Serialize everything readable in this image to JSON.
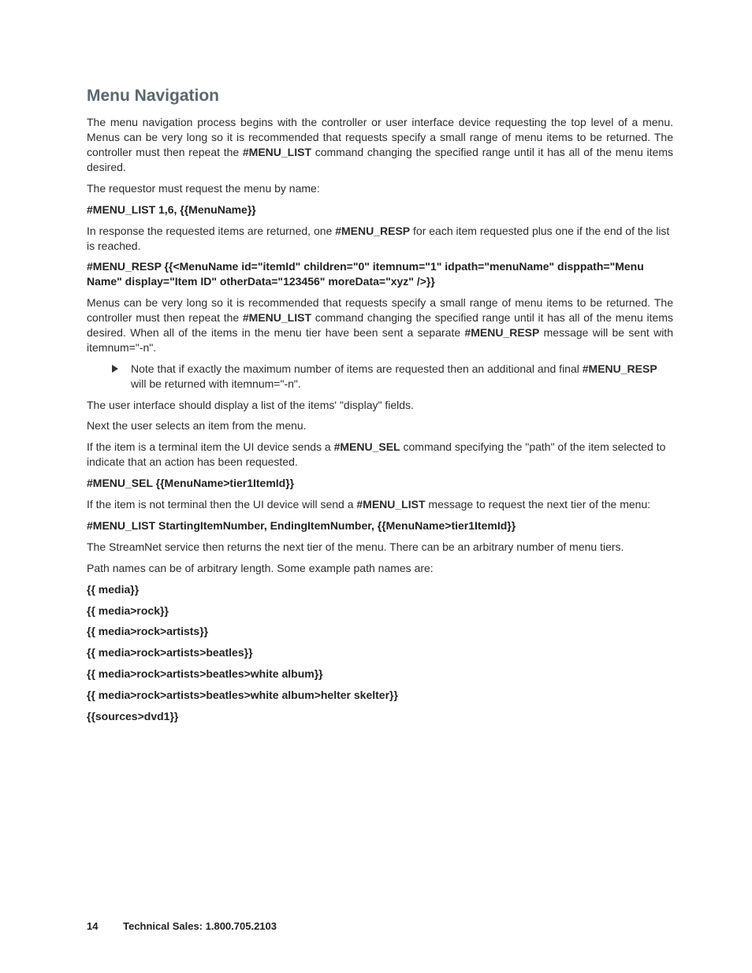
{
  "heading": "Menu Navigation",
  "p1_a": "The menu navigation process begins with the controller or user interface device requesting the top level of a menu. Menus can be very long so it is recommended that requests specify a small range of menu items to be returned. The controller must then repeat the ",
  "p1_cmd": "#MENU_LIST",
  "p1_b": " command changing the specified range until it has all of the menu items desired.",
  "p2": "The requestor must request the menu by name:",
  "cmd1": "#MENU_LIST 1,6, {{MenuName}}",
  "p3_a": "In response the requested items are returned, one ",
  "p3_cmd": "#MENU_RESP",
  "p3_b": " for each item requested plus one if the end of the list is reached.",
  "cmd2": "#MENU_RESP {{<MenuName id=\"itemId\" children=\"0\" itemnum=\"1\" idpath=\"menuName\" disppath=\"Menu Name\" display=\"Item ID\" otherData=\"123456\" moreData=\"xyz\" />}}",
  "p4_a": "Menus can be very long so it is recommended that requests specify a small range of menu items to be returned. The controller must then repeat the ",
  "p4_cmd1": "#MENU_LIST",
  "p4_b": " command changing the specified range until it has all of the menu items desired. When all of the items in the menu tier have been sent a separate ",
  "p4_cmd2": "#MENU_RESP",
  "p4_c": " message will be sent with  itemnum=\"-n\".",
  "note_a": "Note that if exactly the maximum number of items are requested then an additional and final ",
  "note_cmd": "#MENU_RESP",
  "note_b": " will be returned with itemnum=\"-n\".",
  "p5": "The user interface should display a list of the items' \"display\" fields.",
  "p6": "Next the user selects an item from the menu.",
  "p7_a": "If the item is a terminal item the UI device sends a ",
  "p7_cmd": "#MENU_SEL",
  "p7_b": " command specifying the \"path\" of the item selected to indicate that an action has been requested.",
  "cmd3": "#MENU_SEL {{MenuName>tier1ItemId}}",
  "p8_a": "If the item is not terminal then the UI device will send a ",
  "p8_cmd": "#MENU_LIST",
  "p8_b": " message to request the next tier of the menu:",
  "cmd4": "#MENU_LIST StartingItemNumber, EndingItemNumber, {{MenuName>tier1ItemId}}",
  "p9": "The StreamNet service then returns the next tier of the menu. There can be an arbitrary number of menu tiers.",
  "p10": "Path names can be of arbitrary length. Some example path names are:",
  "paths": {
    "0": "{{ media}}",
    "1": "{{ media>rock}}",
    "2": "{{ media>rock>artists}}",
    "3": "{{ media>rock>artists>beatles}}",
    "4": "{{ media>rock>artists>beatles>white album}}",
    "5": "{{ media>rock>artists>beatles>white album>helter skelter}}",
    "6": "{{sources>dvd1}}"
  },
  "footer": {
    "page": "14",
    "label": "Technical Sales:   1.800.705.2103"
  }
}
